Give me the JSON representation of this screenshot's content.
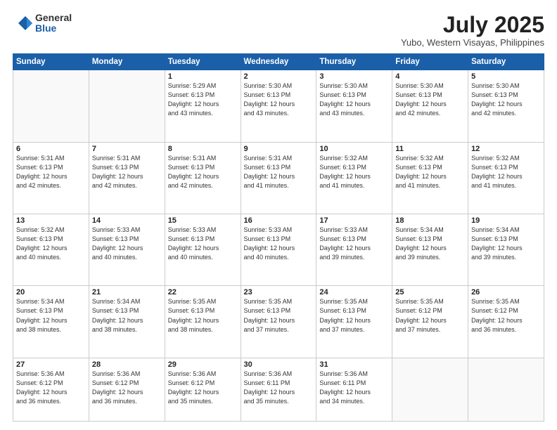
{
  "logo": {
    "general": "General",
    "blue": "Blue"
  },
  "header": {
    "month_year": "July 2025",
    "location": "Yubo, Western Visayas, Philippines"
  },
  "weekdays": [
    "Sunday",
    "Monday",
    "Tuesday",
    "Wednesday",
    "Thursday",
    "Friday",
    "Saturday"
  ],
  "weeks": [
    [
      {
        "day": "",
        "info": ""
      },
      {
        "day": "",
        "info": ""
      },
      {
        "day": "1",
        "info": "Sunrise: 5:29 AM\nSunset: 6:13 PM\nDaylight: 12 hours\nand 43 minutes."
      },
      {
        "day": "2",
        "info": "Sunrise: 5:30 AM\nSunset: 6:13 PM\nDaylight: 12 hours\nand 43 minutes."
      },
      {
        "day": "3",
        "info": "Sunrise: 5:30 AM\nSunset: 6:13 PM\nDaylight: 12 hours\nand 43 minutes."
      },
      {
        "day": "4",
        "info": "Sunrise: 5:30 AM\nSunset: 6:13 PM\nDaylight: 12 hours\nand 42 minutes."
      },
      {
        "day": "5",
        "info": "Sunrise: 5:30 AM\nSunset: 6:13 PM\nDaylight: 12 hours\nand 42 minutes."
      }
    ],
    [
      {
        "day": "6",
        "info": "Sunrise: 5:31 AM\nSunset: 6:13 PM\nDaylight: 12 hours\nand 42 minutes."
      },
      {
        "day": "7",
        "info": "Sunrise: 5:31 AM\nSunset: 6:13 PM\nDaylight: 12 hours\nand 42 minutes."
      },
      {
        "day": "8",
        "info": "Sunrise: 5:31 AM\nSunset: 6:13 PM\nDaylight: 12 hours\nand 42 minutes."
      },
      {
        "day": "9",
        "info": "Sunrise: 5:31 AM\nSunset: 6:13 PM\nDaylight: 12 hours\nand 41 minutes."
      },
      {
        "day": "10",
        "info": "Sunrise: 5:32 AM\nSunset: 6:13 PM\nDaylight: 12 hours\nand 41 minutes."
      },
      {
        "day": "11",
        "info": "Sunrise: 5:32 AM\nSunset: 6:13 PM\nDaylight: 12 hours\nand 41 minutes."
      },
      {
        "day": "12",
        "info": "Sunrise: 5:32 AM\nSunset: 6:13 PM\nDaylight: 12 hours\nand 41 minutes."
      }
    ],
    [
      {
        "day": "13",
        "info": "Sunrise: 5:32 AM\nSunset: 6:13 PM\nDaylight: 12 hours\nand 40 minutes."
      },
      {
        "day": "14",
        "info": "Sunrise: 5:33 AM\nSunset: 6:13 PM\nDaylight: 12 hours\nand 40 minutes."
      },
      {
        "day": "15",
        "info": "Sunrise: 5:33 AM\nSunset: 6:13 PM\nDaylight: 12 hours\nand 40 minutes."
      },
      {
        "day": "16",
        "info": "Sunrise: 5:33 AM\nSunset: 6:13 PM\nDaylight: 12 hours\nand 40 minutes."
      },
      {
        "day": "17",
        "info": "Sunrise: 5:33 AM\nSunset: 6:13 PM\nDaylight: 12 hours\nand 39 minutes."
      },
      {
        "day": "18",
        "info": "Sunrise: 5:34 AM\nSunset: 6:13 PM\nDaylight: 12 hours\nand 39 minutes."
      },
      {
        "day": "19",
        "info": "Sunrise: 5:34 AM\nSunset: 6:13 PM\nDaylight: 12 hours\nand 39 minutes."
      }
    ],
    [
      {
        "day": "20",
        "info": "Sunrise: 5:34 AM\nSunset: 6:13 PM\nDaylight: 12 hours\nand 38 minutes."
      },
      {
        "day": "21",
        "info": "Sunrise: 5:34 AM\nSunset: 6:13 PM\nDaylight: 12 hours\nand 38 minutes."
      },
      {
        "day": "22",
        "info": "Sunrise: 5:35 AM\nSunset: 6:13 PM\nDaylight: 12 hours\nand 38 minutes."
      },
      {
        "day": "23",
        "info": "Sunrise: 5:35 AM\nSunset: 6:13 PM\nDaylight: 12 hours\nand 37 minutes."
      },
      {
        "day": "24",
        "info": "Sunrise: 5:35 AM\nSunset: 6:13 PM\nDaylight: 12 hours\nand 37 minutes."
      },
      {
        "day": "25",
        "info": "Sunrise: 5:35 AM\nSunset: 6:12 PM\nDaylight: 12 hours\nand 37 minutes."
      },
      {
        "day": "26",
        "info": "Sunrise: 5:35 AM\nSunset: 6:12 PM\nDaylight: 12 hours\nand 36 minutes."
      }
    ],
    [
      {
        "day": "27",
        "info": "Sunrise: 5:36 AM\nSunset: 6:12 PM\nDaylight: 12 hours\nand 36 minutes."
      },
      {
        "day": "28",
        "info": "Sunrise: 5:36 AM\nSunset: 6:12 PM\nDaylight: 12 hours\nand 36 minutes."
      },
      {
        "day": "29",
        "info": "Sunrise: 5:36 AM\nSunset: 6:12 PM\nDaylight: 12 hours\nand 35 minutes."
      },
      {
        "day": "30",
        "info": "Sunrise: 5:36 AM\nSunset: 6:11 PM\nDaylight: 12 hours\nand 35 minutes."
      },
      {
        "day": "31",
        "info": "Sunrise: 5:36 AM\nSunset: 6:11 PM\nDaylight: 12 hours\nand 34 minutes."
      },
      {
        "day": "",
        "info": ""
      },
      {
        "day": "",
        "info": ""
      }
    ]
  ]
}
